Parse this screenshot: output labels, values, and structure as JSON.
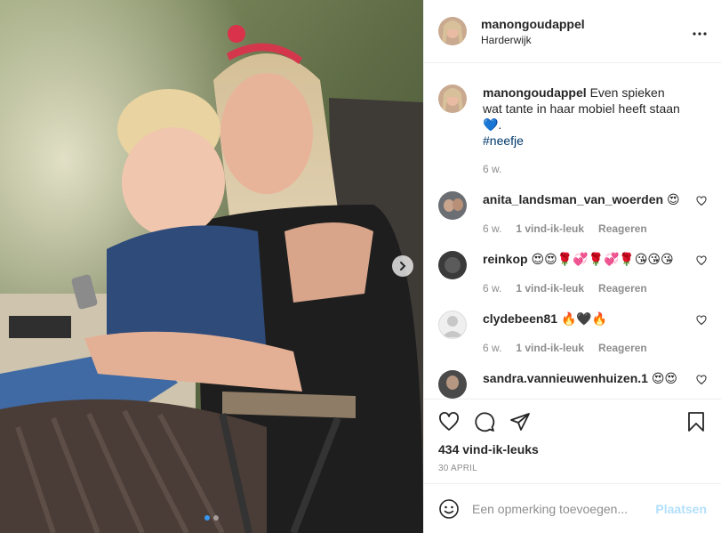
{
  "post": {
    "username": "manongoudappel",
    "location": "Harderwijk",
    "photo_alt": "Even spieken wat tante in haar mobiel heeft staan",
    "carousel": {
      "count": 2,
      "active": 1
    }
  },
  "caption": {
    "username": "manongoudappel",
    "text": "Even spieken wat tante in haar mobiel heeft staan💙.",
    "hashtag": "#neefje",
    "time": "6 w."
  },
  "comments": [
    {
      "username": "anita_landsman_van_woerden",
      "text": "😍",
      "time": "6 w.",
      "likes": "1 vind-ik-leuk",
      "reply": "Reageren"
    },
    {
      "username": "reinkop",
      "text": "😍😍🌹💞🌹💞🌹😘😘😘",
      "time": "6 w.",
      "likes": "1 vind-ik-leuk",
      "reply": "Reageren"
    },
    {
      "username": "clydebeen81",
      "text": "🔥🖤🔥",
      "time": "6 w.",
      "likes": "1 vind-ik-leuk",
      "reply": "Reageren"
    },
    {
      "username": "sandra.vannieuwenhuizen.1",
      "text": "😍😍",
      "time": "",
      "likes": "",
      "reply": ""
    }
  ],
  "footer": {
    "likes": "434 vind-ik-leuks",
    "date": "30 april",
    "comment_placeholder": "Een opmerking toevoegen...",
    "post_label": "Plaatsen"
  },
  "colors": {
    "link": "#00376b",
    "muted": "#8e8e8e",
    "post_disabled": "#b2dffc",
    "border": "#efefef",
    "active_dot": "#3897f0"
  },
  "icons": [
    "more-options-icon",
    "heart-icon",
    "comment-icon",
    "share-icon",
    "bookmark-icon",
    "emoji-icon",
    "chevron-right-icon"
  ]
}
